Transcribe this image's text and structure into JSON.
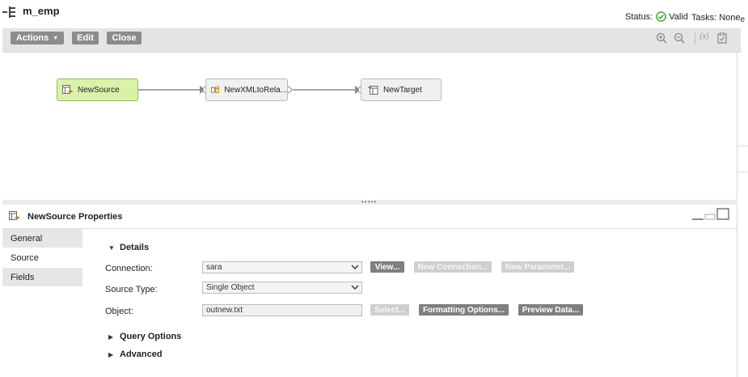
{
  "header": {
    "title": "m_emp",
    "status_label": "Status:",
    "status_value": "Valid",
    "tasks_label": "Tasks: None",
    "tasks_suffix": "e"
  },
  "toolbar": {
    "actions_label": "Actions",
    "edit_label": "Edit",
    "close_label": "Close",
    "fx_label": "(x)"
  },
  "canvas": {
    "nodes": [
      {
        "label": "NewSource",
        "icon": "source-table-icon"
      },
      {
        "label": "NewXMLtoRela...",
        "icon": "xml-relational-icon"
      },
      {
        "label": "NewTarget",
        "icon": "target-table-icon"
      }
    ]
  },
  "properties": {
    "title": "NewSource Properties",
    "tabs": [
      {
        "label": "General"
      },
      {
        "label": "Source"
      },
      {
        "label": "Fields"
      }
    ],
    "details_label": "Details",
    "connection_label": "Connection:",
    "connection_value": "sara",
    "view_label": "View...",
    "new_connection_label": "New Connection...",
    "new_parameter_label": "New Parameter...",
    "source_type_label": "Source Type:",
    "source_type_value": "Single Object",
    "object_label": "Object:",
    "object_value": "outnew.txt",
    "select_label": "Select...",
    "formatting_label": "Formatting Options...",
    "preview_label": "Preview Data...",
    "query_options_label": "Query Options",
    "advanced_label": "Advanced"
  },
  "colors": {
    "source_node_fill": "#d9f2a8",
    "source_node_border": "#8cc152",
    "valid_green": "#3a9d23",
    "toolbar_button": "#8c8c8c"
  }
}
